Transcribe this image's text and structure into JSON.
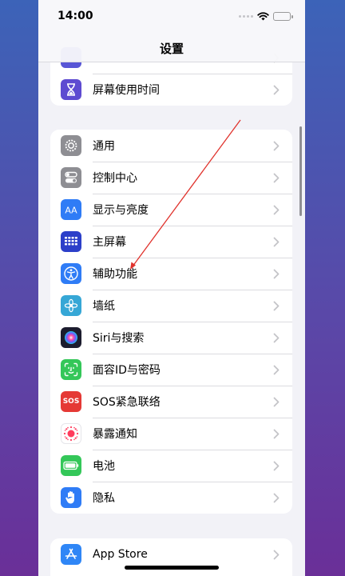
{
  "status_bar": {
    "time": "14:00"
  },
  "nav": {
    "title": "设置"
  },
  "groups": [
    {
      "items": [
        {
          "label": "",
          "icon": "hidden-partial-icon",
          "color": "#5856d6"
        },
        {
          "label": "屏幕使用时间",
          "icon": "hourglass-icon",
          "color": "#5e4bd1"
        }
      ]
    },
    {
      "items": [
        {
          "label": "通用",
          "icon": "gear-icon",
          "color": "#8e8e93"
        },
        {
          "label": "控制中心",
          "icon": "toggle-switches-icon",
          "color": "#8e8e93"
        },
        {
          "label": "显示与亮度",
          "icon": "text-size-aa-icon",
          "color": "#2f7cf6"
        },
        {
          "label": "主屏幕",
          "icon": "home-grid-icon",
          "color": "#2c3fc9"
        },
        {
          "label": "辅助功能",
          "icon": "accessibility-icon",
          "color": "#2f7cf6"
        },
        {
          "label": "墙纸",
          "icon": "flower-icon",
          "color": "#36a7d6"
        },
        {
          "label": "Siri与搜索",
          "icon": "siri-icon",
          "color": "#1c1c2e"
        },
        {
          "label": "面容ID与密码",
          "icon": "face-id-icon",
          "color": "#34c759"
        },
        {
          "label": "SOS紧急联络",
          "icon": "sos-icon",
          "color": "#e53935",
          "icon_text": "SOS"
        },
        {
          "label": "暴露通知",
          "icon": "exposure-notification-icon",
          "color": "#ffffff"
        },
        {
          "label": "电池",
          "icon": "battery-icon",
          "color": "#34c759"
        },
        {
          "label": "隐私",
          "icon": "hand-icon",
          "color": "#2f7cf6"
        }
      ]
    },
    {
      "items": [
        {
          "label": "App Store",
          "icon": "app-store-icon",
          "color": "#2f86f6"
        }
      ]
    }
  ],
  "annotation": {
    "type": "red-arrow",
    "color": "#e0322c",
    "points_to": "辅助功能"
  }
}
